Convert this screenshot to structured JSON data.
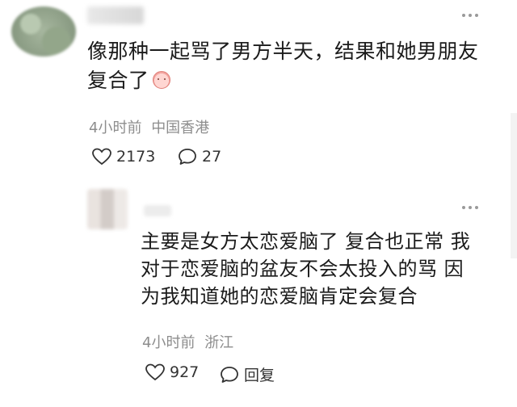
{
  "comment": {
    "text_line1": "像那种一起骂了男方半天，结果和她男朋友",
    "text_line2": "复合了",
    "time": "4小时前",
    "location": "中国香港",
    "likes": "2173",
    "replies": "27"
  },
  "reply": {
    "text_line1": "主要是女方太恋爱脑了 复合也正常 我",
    "text_line2": "对于恋爱脑的盆友不会太投入的骂 因",
    "text_line3": "为我知道她的恋爱脑肯定会复合",
    "time": "4小时前",
    "location": "浙江",
    "likes": "927",
    "reply_label": "回复"
  },
  "icons": [
    "heart-icon",
    "comment-bubble-icon",
    "more-dots-icon"
  ],
  "colors": {
    "text": "#1b1b1b",
    "meta": "#8d8d8d",
    "icon": "#333333"
  }
}
